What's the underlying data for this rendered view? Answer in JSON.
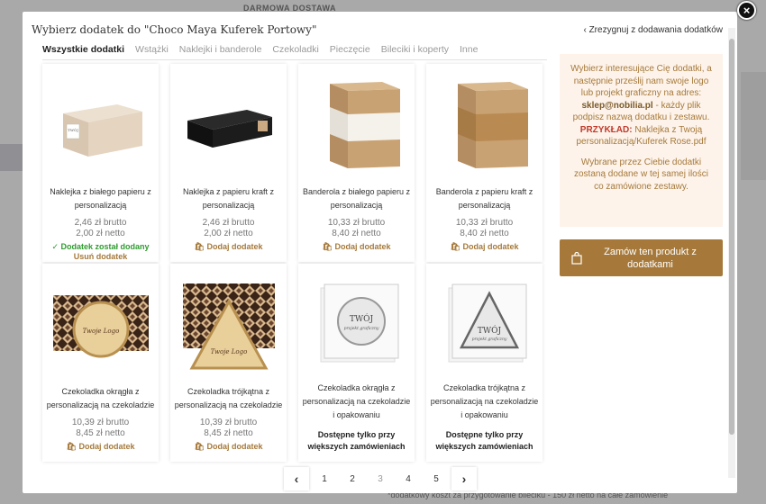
{
  "background": {
    "top_strip": "DARMOWA DOSTAWA",
    "bottom_strip": "*dodatkowy koszt za przygotowanie bileciku - 150 zł netto na całe zamówienie"
  },
  "modal": {
    "title": "Wybierz dodatek do \"Choco Maya Kuferek Portowy\"",
    "resign_label": "Zrezygnuj z dodawania dodatków",
    "close_label": "×"
  },
  "tabs": [
    {
      "label": "Wszystkie dodatki",
      "active": true
    },
    {
      "label": "Wstążki"
    },
    {
      "label": "Naklejki i banderole"
    },
    {
      "label": "Czekoladki"
    },
    {
      "label": "Pieczęcie"
    },
    {
      "label": "Bileciki i koperty"
    },
    {
      "label": "Inne"
    }
  ],
  "products": [
    {
      "name": "Naklejka z białego papieru z personalizacją",
      "gross": "2,46 zł brutto",
      "net": "2,00 zł netto",
      "action": "Dodatek został dodany",
      "remove": "Usuń dodatek",
      "image": "white-box-sticker"
    },
    {
      "name": "Naklejka z papieru kraft z personalizacją",
      "gross": "2,46 zł brutto",
      "net": "2,00 zł netto",
      "action": "Dodaj dodatek",
      "image": "black-box-kraft-sticker"
    },
    {
      "name": "Banderola z białego papieru z personalizacją",
      "gross": "10,33 zł brutto",
      "net": "8,40 zł netto",
      "action": "Dodaj dodatek",
      "image": "kraft-box-white-band"
    },
    {
      "name": "Banderola z papieru kraft z personalizacją",
      "gross": "10,33 zł brutto",
      "net": "8,40 zł netto",
      "action": "Dodaj dodatek",
      "image": "kraft-box-kraft-band"
    },
    {
      "name": "Czekoladka okrągła z personalizacją na czekoladzie",
      "gross": "10,39 zł brutto",
      "net": "8,45 zł netto",
      "action": "Dodaj dodatek",
      "image": "round-chocolate"
    },
    {
      "name": "Czekoladka trójkątna z personalizacją na czekoladzie",
      "gross": "10,39 zł brutto",
      "net": "8,45 zł netto",
      "action": "Dodaj dodatek",
      "image": "triangle-chocolate"
    },
    {
      "name": "Czekoladka okrągła z personalizacją na czekoladzie i opakowaniu",
      "unavailable": "Dostępne tylko przy większych zamówieniach",
      "image": "round-packaged",
      "img_text_1": "TWÓJ",
      "img_text_2": "projekt graficzny"
    },
    {
      "name": "Czekoladka trójkątna z personalizacją na czekoladzie i opakowaniu",
      "unavailable": "Dostępne tylko przy większych zamówieniach",
      "image": "triangle-packaged",
      "img_text_1": "TWÓJ",
      "img_text_2": "projekt graficzny"
    }
  ],
  "image_texts": {
    "sticker": "TWÓJ",
    "choc_text": "Twoje Logo"
  },
  "info": {
    "p1": "Wybierz interesujące Cię dodatki, a następnie prześlij nam swoje logo lub projekt graficzny na adres:",
    "email": "sklep@nobilia.pl",
    "p1b": "- każdy plik podpisz nazwą dodatku i zestawu.",
    "example_label": "PRZYKŁAD:",
    "example_text": "Naklejka z Twoją personalizacją/Kuferek Rose.pdf",
    "p2": "Wybrane przez Ciebie dodatki zostaną dodane w tej samej ilości co zamówione zestawy."
  },
  "order_button": "Zamów ten produkt z dodatkami",
  "pagination": {
    "prev": "‹",
    "next": "›",
    "pages": [
      "1",
      "2",
      "3",
      "4",
      "5"
    ],
    "current": "3"
  },
  "colors": {
    "accent": "#a6793a",
    "added": "#2e9c2e",
    "example": "#c0392b",
    "info_bg": "#fdf3ea"
  }
}
